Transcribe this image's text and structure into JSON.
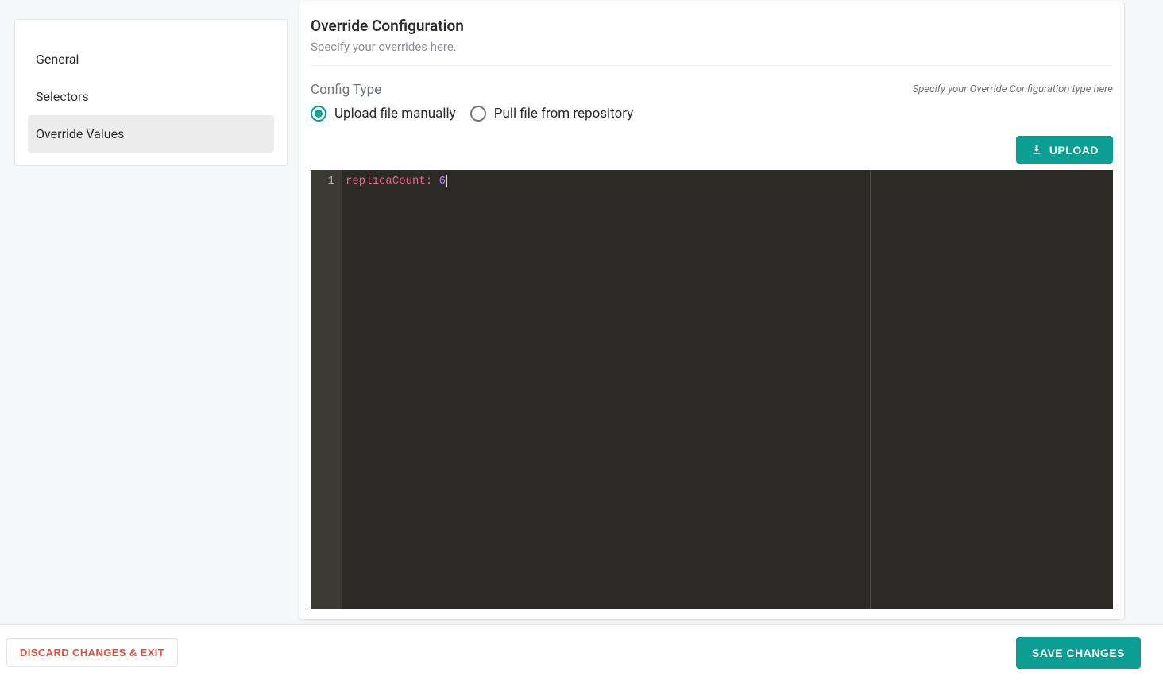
{
  "sidebar": {
    "items": [
      {
        "label": "General",
        "active": false
      },
      {
        "label": "Selectors",
        "active": false
      },
      {
        "label": "Override Values",
        "active": true
      }
    ]
  },
  "panel": {
    "title": "Override Configuration",
    "subtitle": "Specify your overrides here."
  },
  "config": {
    "label": "Config Type",
    "hint": "Specify your Override Configuration type here",
    "options": [
      {
        "label": "Upload file manually",
        "selected": true
      },
      {
        "label": "Pull file from repository",
        "selected": false
      }
    ],
    "upload_label": "UPLOAD"
  },
  "editor": {
    "lines": [
      {
        "num": "1",
        "key": "replicaCount:",
        "value": "6"
      }
    ]
  },
  "footer": {
    "discard_label": "DISCARD CHANGES & EXIT",
    "save_label": "SAVE CHANGES"
  },
  "colors": {
    "accent": "#0b9e92",
    "danger": "#e74c3c"
  }
}
